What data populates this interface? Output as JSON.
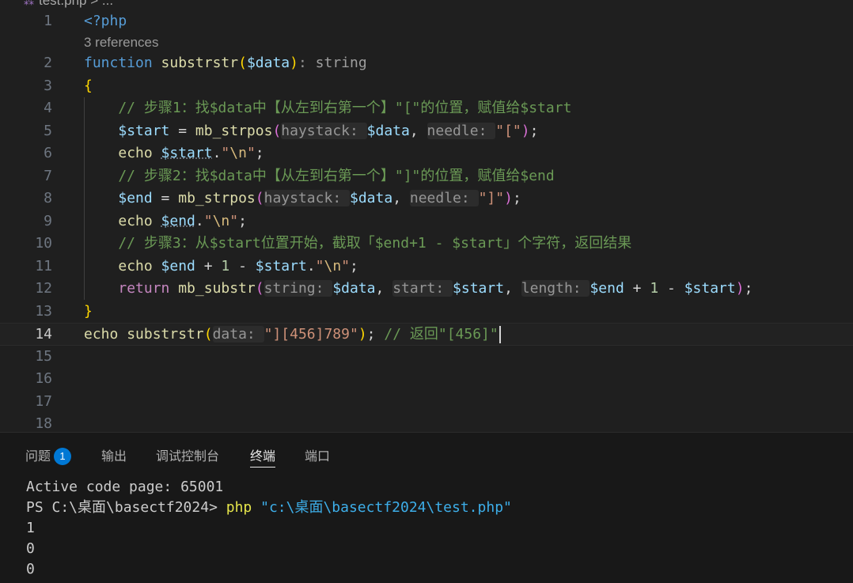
{
  "breadcrumb": {
    "file": "test.php",
    "trail": "> ..."
  },
  "editor": {
    "current_line": 14,
    "refs_text": "3 references",
    "lines": [
      {
        "n": "1",
        "segs": [
          [
            "<?php",
            "kw"
          ]
        ]
      },
      {
        "n": "2",
        "segs": [
          [
            "function ",
            "kw"
          ],
          [
            "substrstr",
            "fn"
          ],
          [
            "(",
            "br1"
          ],
          [
            "$data",
            "var"
          ],
          [
            ")",
            "br1"
          ],
          [
            ": ",
            "hint"
          ],
          [
            "string",
            "dim"
          ]
        ]
      },
      {
        "n": "3",
        "segs": [
          [
            "{",
            "br1"
          ]
        ]
      },
      {
        "n": "4",
        "segs": [
          [
            "    // 步骤1：找$data中【从左到右第一个】\"[\"的位置，赋值给$start",
            "cm"
          ]
        ]
      },
      {
        "n": "5",
        "segs": [
          [
            "    ",
            "pl"
          ],
          [
            "$start",
            "var"
          ],
          [
            " = ",
            "pl"
          ],
          [
            "mb_strpos",
            "fn"
          ],
          [
            "(",
            "br2"
          ],
          [
            "haystack: ",
            "hintbox"
          ],
          [
            "$data",
            "var"
          ],
          [
            ", ",
            "pl"
          ],
          [
            "needle: ",
            "hintbox"
          ],
          [
            "\"[\"",
            "str"
          ],
          [
            ")",
            "br2"
          ],
          [
            ";",
            "pl"
          ]
        ]
      },
      {
        "n": "6",
        "segs": [
          [
            "    ",
            "pl"
          ],
          [
            "echo ",
            "fn"
          ],
          [
            "$start",
            "var dotu"
          ],
          [
            ".",
            "pl"
          ],
          [
            "\"",
            "str"
          ],
          [
            "\\n",
            "esc"
          ],
          [
            "\"",
            "str"
          ],
          [
            ";",
            "pl"
          ]
        ]
      },
      {
        "n": "7",
        "segs": [
          [
            "    // 步骤2：找$data中【从左到右第一个】\"]\"的位置，赋值给$end",
            "cm"
          ]
        ]
      },
      {
        "n": "8",
        "segs": [
          [
            "    ",
            "pl"
          ],
          [
            "$end",
            "var"
          ],
          [
            " = ",
            "pl"
          ],
          [
            "mb_strpos",
            "fn"
          ],
          [
            "(",
            "br2"
          ],
          [
            "haystack: ",
            "hintbox"
          ],
          [
            "$data",
            "var"
          ],
          [
            ", ",
            "pl"
          ],
          [
            "needle: ",
            "hintbox"
          ],
          [
            "\"]\"",
            "str"
          ],
          [
            ")",
            "br2"
          ],
          [
            ";",
            "pl"
          ]
        ]
      },
      {
        "n": "9",
        "segs": [
          [
            "    ",
            "pl"
          ],
          [
            "echo ",
            "fn"
          ],
          [
            "$end",
            "var dotu"
          ],
          [
            ".",
            "pl"
          ],
          [
            "\"",
            "str"
          ],
          [
            "\\n",
            "esc"
          ],
          [
            "\"",
            "str"
          ],
          [
            ";",
            "pl"
          ]
        ]
      },
      {
        "n": "10",
        "segs": [
          [
            "    // 步骤3：从$start位置开始，截取「$end+1 - $start」个字符，返回结果",
            "cm"
          ]
        ]
      },
      {
        "n": "11",
        "segs": [
          [
            "    ",
            "pl"
          ],
          [
            "echo ",
            "fn"
          ],
          [
            "$end",
            "var"
          ],
          [
            " + ",
            "pl"
          ],
          [
            "1",
            "num"
          ],
          [
            " - ",
            "pl"
          ],
          [
            "$start",
            "var"
          ],
          [
            ".",
            "pl"
          ],
          [
            "\"",
            "str"
          ],
          [
            "\\n",
            "esc"
          ],
          [
            "\"",
            "str"
          ],
          [
            ";",
            "pl"
          ]
        ]
      },
      {
        "n": "12",
        "segs": [
          [
            "    ",
            "pl"
          ],
          [
            "return ",
            "kc"
          ],
          [
            "mb_substr",
            "fn"
          ],
          [
            "(",
            "br2"
          ],
          [
            "string: ",
            "hintbox"
          ],
          [
            "$data",
            "var"
          ],
          [
            ", ",
            "pl"
          ],
          [
            "start: ",
            "hintbox"
          ],
          [
            "$start",
            "var"
          ],
          [
            ", ",
            "pl"
          ],
          [
            "length: ",
            "hintbox"
          ],
          [
            "$end",
            "var"
          ],
          [
            " + ",
            "pl"
          ],
          [
            "1",
            "num"
          ],
          [
            " - ",
            "pl"
          ],
          [
            "$start",
            "var"
          ],
          [
            ")",
            "br2"
          ],
          [
            ";",
            "pl"
          ]
        ]
      },
      {
        "n": "13",
        "segs": [
          [
            "}",
            "br1"
          ]
        ]
      },
      {
        "n": "14",
        "segs": [
          [
            "echo ",
            "fn"
          ],
          [
            "substrstr",
            "fn"
          ],
          [
            "(",
            "br1"
          ],
          [
            "data: ",
            "hintbox"
          ],
          [
            "\"][456]789\"",
            "str"
          ],
          [
            ")",
            "br1"
          ],
          [
            "; ",
            "pl"
          ],
          [
            "// 返回\"[456]\"",
            "cm"
          ]
        ]
      },
      {
        "n": "15",
        "segs": []
      },
      {
        "n": "16",
        "segs": []
      },
      {
        "n": "17",
        "segs": []
      },
      {
        "n": "18",
        "segs": []
      }
    ]
  },
  "panel": {
    "tabs": [
      {
        "label": "问题",
        "badge": "1"
      },
      {
        "label": "输出"
      },
      {
        "label": "调试控制台"
      },
      {
        "label": "终端",
        "active": true
      },
      {
        "label": "端口"
      }
    ],
    "terminal": [
      [
        [
          "Active code page: 65001",
          ""
        ]
      ],
      [
        [
          "PS C:\\桌面\\basectf2024> ",
          ""
        ],
        [
          "php",
          "t-cmd"
        ],
        [
          " ",
          ""
        ],
        [
          "\"c:\\桌面\\basectf2024\\test.php\"",
          "t-str"
        ]
      ],
      [
        [
          "1",
          ""
        ]
      ],
      [
        [
          "0",
          ""
        ]
      ],
      [
        [
          "0",
          ""
        ]
      ]
    ]
  },
  "colors": {
    "background": "#1f1f1f",
    "panel": "#181818",
    "badge": "#0078d4",
    "comment": "#6a9955",
    "keyword": "#569cd6"
  }
}
